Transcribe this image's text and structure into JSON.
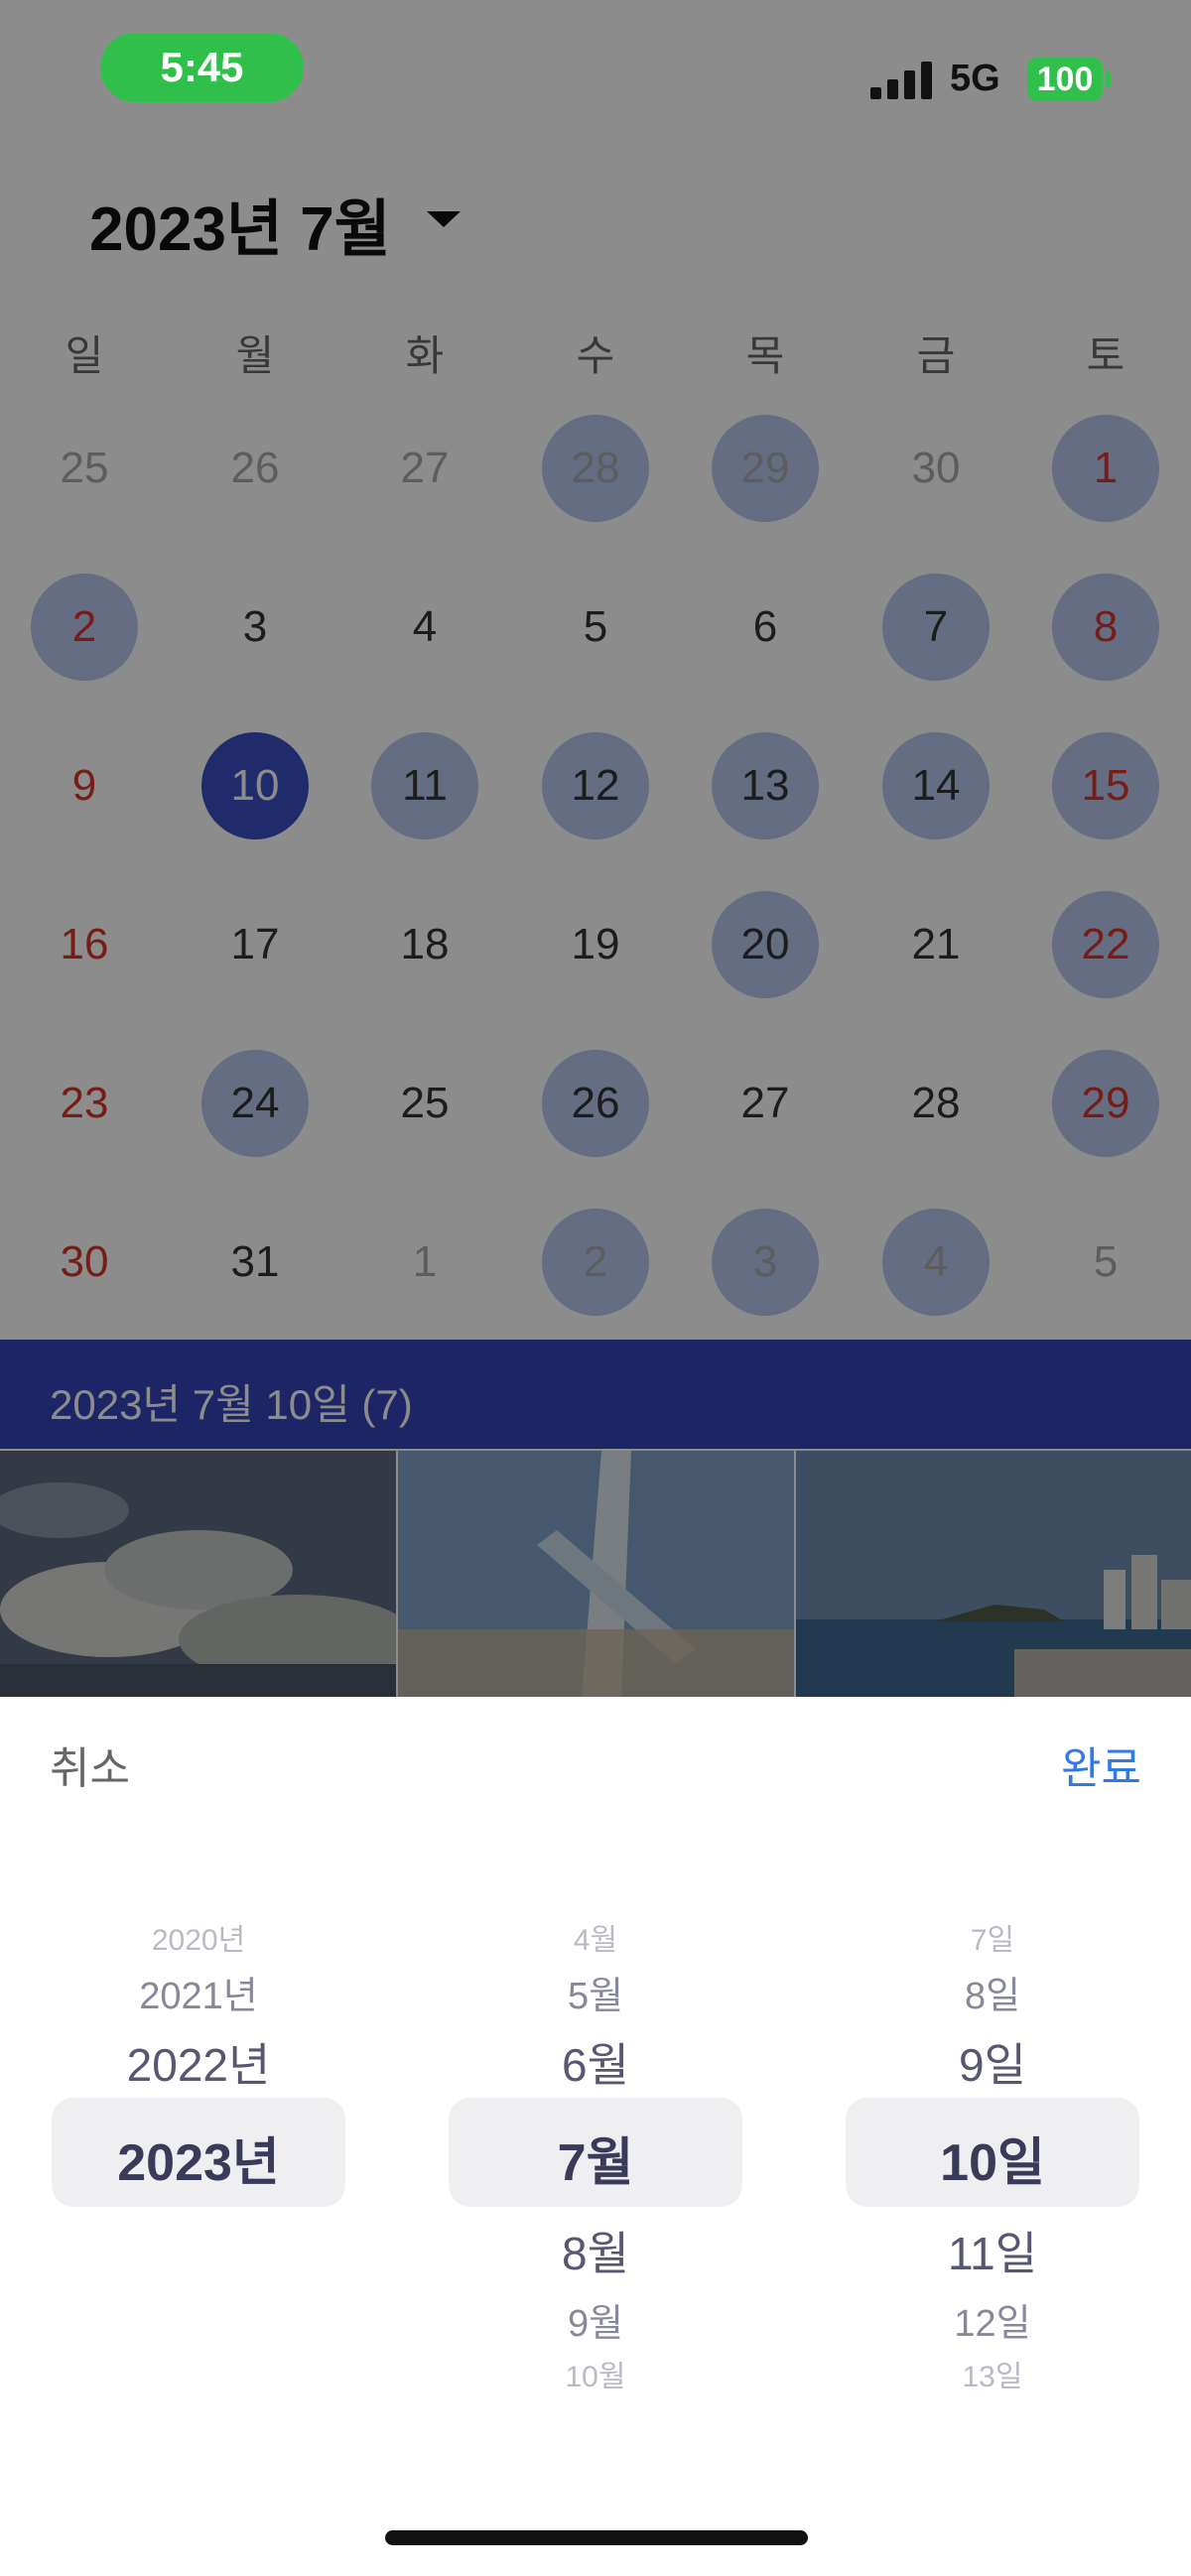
{
  "status_bar": {
    "time": "5:45",
    "network": "5G",
    "battery": "100"
  },
  "calendar": {
    "title": "2023년 7월",
    "weekdays": [
      "일",
      "월",
      "화",
      "수",
      "목",
      "금",
      "토"
    ],
    "weeks": [
      [
        {
          "d": "25",
          "muted": true,
          "red": false,
          "mark": false,
          "sel": false
        },
        {
          "d": "26",
          "muted": true,
          "red": false,
          "mark": false,
          "sel": false
        },
        {
          "d": "27",
          "muted": true,
          "red": false,
          "mark": false,
          "sel": false
        },
        {
          "d": "28",
          "muted": true,
          "red": false,
          "mark": true,
          "sel": false
        },
        {
          "d": "29",
          "muted": true,
          "red": false,
          "mark": true,
          "sel": false
        },
        {
          "d": "30",
          "muted": true,
          "red": false,
          "mark": false,
          "sel": false
        },
        {
          "d": "1",
          "muted": false,
          "red": true,
          "mark": true,
          "sel": false
        }
      ],
      [
        {
          "d": "2",
          "muted": false,
          "red": true,
          "mark": true,
          "sel": false
        },
        {
          "d": "3",
          "muted": false,
          "red": false,
          "mark": false,
          "sel": false
        },
        {
          "d": "4",
          "muted": false,
          "red": false,
          "mark": false,
          "sel": false
        },
        {
          "d": "5",
          "muted": false,
          "red": false,
          "mark": false,
          "sel": false
        },
        {
          "d": "6",
          "muted": false,
          "red": false,
          "mark": false,
          "sel": false
        },
        {
          "d": "7",
          "muted": false,
          "red": false,
          "mark": true,
          "sel": false
        },
        {
          "d": "8",
          "muted": false,
          "red": true,
          "mark": true,
          "sel": false
        }
      ],
      [
        {
          "d": "9",
          "muted": false,
          "red": true,
          "mark": false,
          "sel": false
        },
        {
          "d": "10",
          "muted": false,
          "red": false,
          "mark": false,
          "sel": true
        },
        {
          "d": "11",
          "muted": false,
          "red": false,
          "mark": true,
          "sel": false
        },
        {
          "d": "12",
          "muted": false,
          "red": false,
          "mark": true,
          "sel": false
        },
        {
          "d": "13",
          "muted": false,
          "red": false,
          "mark": true,
          "sel": false
        },
        {
          "d": "14",
          "muted": false,
          "red": false,
          "mark": true,
          "sel": false
        },
        {
          "d": "15",
          "muted": false,
          "red": true,
          "mark": true,
          "sel": false
        }
      ],
      [
        {
          "d": "16",
          "muted": false,
          "red": true,
          "mark": false,
          "sel": false
        },
        {
          "d": "17",
          "muted": false,
          "red": false,
          "mark": false,
          "sel": false
        },
        {
          "d": "18",
          "muted": false,
          "red": false,
          "mark": false,
          "sel": false
        },
        {
          "d": "19",
          "muted": false,
          "red": false,
          "mark": false,
          "sel": false
        },
        {
          "d": "20",
          "muted": false,
          "red": false,
          "mark": true,
          "sel": false
        },
        {
          "d": "21",
          "muted": false,
          "red": false,
          "mark": false,
          "sel": false
        },
        {
          "d": "22",
          "muted": false,
          "red": true,
          "mark": true,
          "sel": false
        }
      ],
      [
        {
          "d": "23",
          "muted": false,
          "red": true,
          "mark": false,
          "sel": false
        },
        {
          "d": "24",
          "muted": false,
          "red": false,
          "mark": true,
          "sel": false
        },
        {
          "d": "25",
          "muted": false,
          "red": false,
          "mark": false,
          "sel": false
        },
        {
          "d": "26",
          "muted": false,
          "red": false,
          "mark": true,
          "sel": false
        },
        {
          "d": "27",
          "muted": false,
          "red": false,
          "mark": false,
          "sel": false
        },
        {
          "d": "28",
          "muted": false,
          "red": false,
          "mark": false,
          "sel": false
        },
        {
          "d": "29",
          "muted": false,
          "red": true,
          "mark": true,
          "sel": false
        }
      ],
      [
        {
          "d": "30",
          "muted": false,
          "red": true,
          "mark": false,
          "sel": false
        },
        {
          "d": "31",
          "muted": false,
          "red": false,
          "mark": false,
          "sel": false
        },
        {
          "d": "1",
          "muted": true,
          "red": false,
          "mark": false,
          "sel": false
        },
        {
          "d": "2",
          "muted": true,
          "red": false,
          "mark": true,
          "sel": false
        },
        {
          "d": "3",
          "muted": true,
          "red": false,
          "mark": true,
          "sel": false
        },
        {
          "d": "4",
          "muted": true,
          "red": false,
          "mark": true,
          "sel": false
        },
        {
          "d": "5",
          "muted": true,
          "red": false,
          "mark": false,
          "sel": false
        }
      ]
    ]
  },
  "selected_date_bar": {
    "label": "2023년 7월 10일 (7)"
  },
  "photos": [
    {
      "name": "cloudy-sky-photo"
    },
    {
      "name": "streaked-sky-photo"
    },
    {
      "name": "coastal-city-photo"
    }
  ],
  "picker": {
    "cancel_label": "취소",
    "done_label": "완료",
    "columns": [
      {
        "name": "year",
        "above": [
          "2020년",
          "2021년",
          "2022년"
        ],
        "selected": "2023년",
        "below": []
      },
      {
        "name": "month",
        "above": [
          "4월",
          "5월",
          "6월"
        ],
        "selected": "7월",
        "below": [
          "8월",
          "9월",
          "10월"
        ]
      },
      {
        "name": "day",
        "above": [
          "7일",
          "8일",
          "9일"
        ],
        "selected": "10일",
        "below": [
          "11일",
          "12일",
          "13일"
        ]
      }
    ]
  },
  "colors": {
    "accent": "#3b4fc4",
    "event_mark": "#b8c6ee",
    "holiday_red": "#d7352b",
    "done_blue": "#2f7ae8",
    "status_green": "#2fbf4a"
  }
}
